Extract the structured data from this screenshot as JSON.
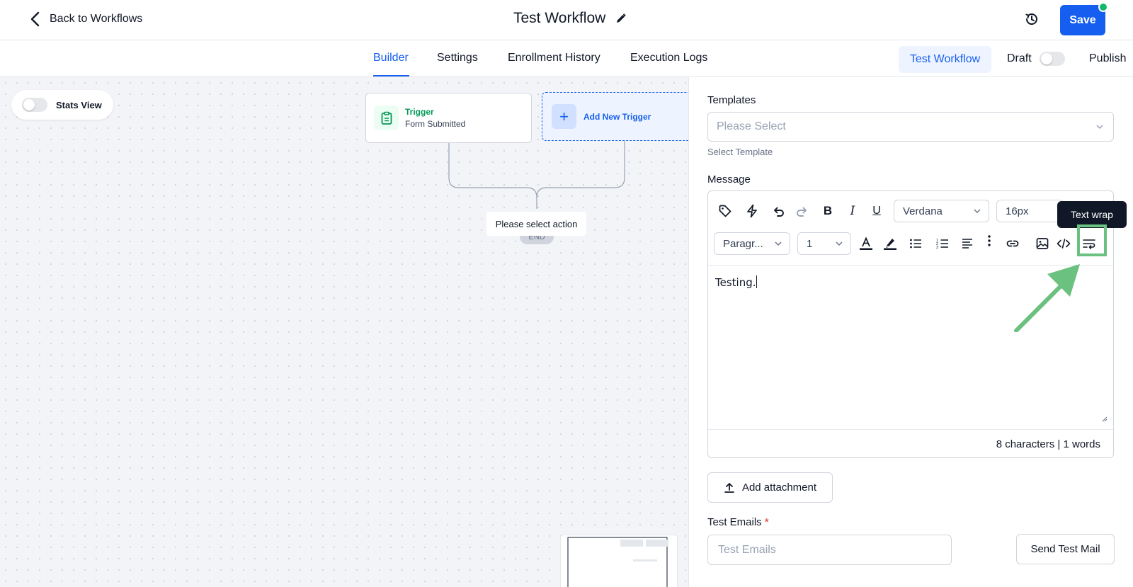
{
  "topbar": {
    "back_label": "Back to Workflows",
    "title": "Test Workflow",
    "save_label": "Save"
  },
  "tabs": [
    {
      "label": "Builder",
      "active": true
    },
    {
      "label": "Settings",
      "active": false
    },
    {
      "label": "Enrollment History",
      "active": false
    },
    {
      "label": "Execution Logs",
      "active": false
    }
  ],
  "subnav": {
    "test_workflow_label": "Test Workflow",
    "draft_label": "Draft",
    "publish_label": "Publish"
  },
  "canvas": {
    "stats_view_label": "Stats View",
    "trigger": {
      "title": "Trigger",
      "subtitle": "Form Submitted"
    },
    "add_trigger_label": "Add New Trigger",
    "action_placeholder": "Please select action",
    "end_label": "END"
  },
  "panel": {
    "templates_label": "Templates",
    "templates_placeholder": "Please Select",
    "templates_help": "Select Template",
    "message_label": "Message",
    "toolbar": {
      "font_family": "Verdana",
      "font_size": "16px",
      "block_format": "Paragr...",
      "line_height": "1",
      "tooltip": "Text wrap"
    },
    "content": "Testing.",
    "counts": "8 characters | 1 words",
    "add_attachment_label": "Add attachment",
    "test_emails_label": "Test Emails",
    "test_emails_required": "*",
    "test_emails_placeholder": "Test Emails",
    "send_test_label": "Send Test Mail"
  },
  "colors": {
    "primary": "#155eef",
    "success": "#12b76a",
    "highlight": "#6bc17f",
    "tooltip_bg": "#101828"
  }
}
